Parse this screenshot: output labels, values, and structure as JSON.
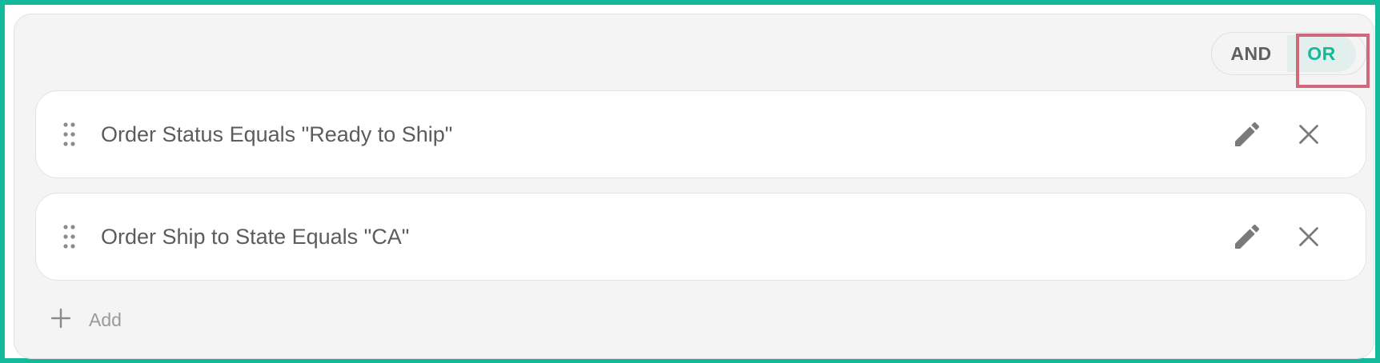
{
  "toggle": {
    "options": [
      "AND",
      "OR"
    ],
    "selected": "OR"
  },
  "rules": [
    {
      "label": "Order Status Equals \"Ready to Ship\""
    },
    {
      "label": "Order Ship to State Equals \"CA\""
    }
  ],
  "add": {
    "label": "Add"
  },
  "colors": {
    "accent": "#14b89a",
    "highlight": "#d0677a",
    "text": "#5c5c5c",
    "icon": "#7a7a7a"
  },
  "icons": {
    "drag": "drag-handle-icon",
    "edit": "pencil-icon",
    "remove": "close-icon",
    "add": "plus-icon"
  }
}
